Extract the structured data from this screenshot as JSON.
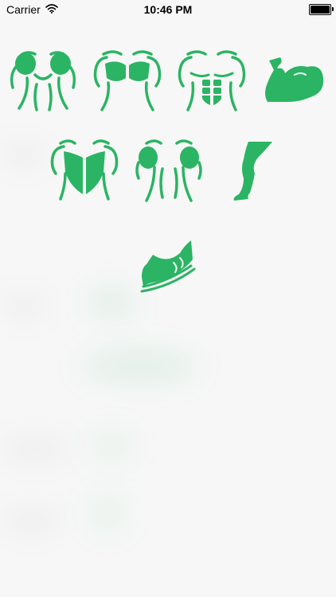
{
  "status_bar": {
    "carrier": "Carrier",
    "time": "10:46 PM",
    "battery_level": 1.0
  },
  "theme": {
    "accent": "#2bb463",
    "background": "#f7f7f7"
  },
  "muscle_groups": [
    {
      "icon": "shoulders-icon"
    },
    {
      "icon": "chest-icon"
    },
    {
      "icon": "abs-icon"
    },
    {
      "icon": "biceps-icon"
    },
    {
      "icon": "back-icon"
    },
    {
      "icon": "triceps-icon"
    },
    {
      "icon": "legs-icon"
    },
    {
      "icon": "cardio-shoe-icon"
    }
  ]
}
